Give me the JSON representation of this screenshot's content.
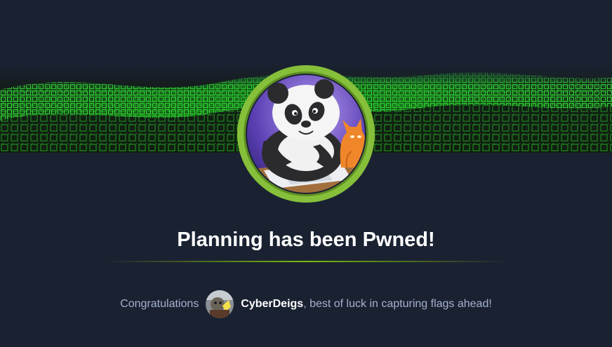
{
  "machine": {
    "title": "Planning has been Pwned!",
    "avatar_icon": "panda-and-cat-machine-avatar"
  },
  "congrats": {
    "prefix": "Congratulations",
    "username": "CyberDeigs",
    "suffix": ", best of luck in capturing flags ahead!"
  },
  "colors": {
    "background": "#1a2232",
    "accent_green": "#9fef00",
    "badge_ring": "#86c03a",
    "text_muted": "#a4b1cd"
  }
}
